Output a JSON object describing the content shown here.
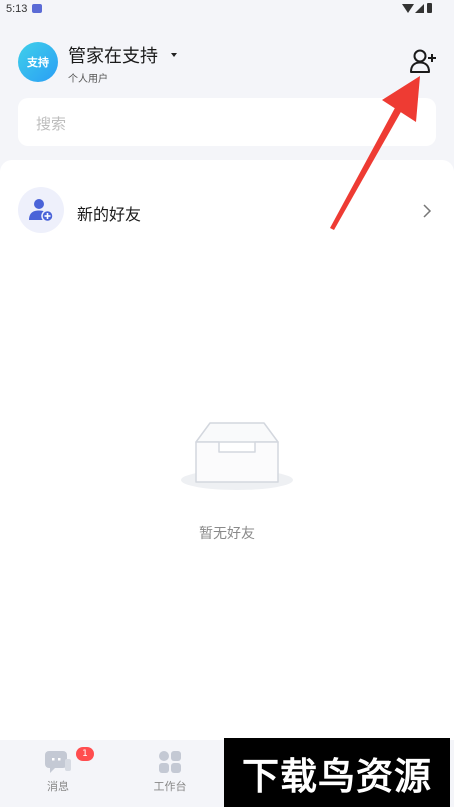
{
  "status_bar": {
    "time": "5:13"
  },
  "header": {
    "avatar_text": "支持",
    "user_name": "管家在支持",
    "user_type": "个人用户",
    "add_friend_icon": "add-user-icon"
  },
  "search": {
    "placeholder": "搜索"
  },
  "contacts": {
    "new_friends_label": "新的好友",
    "new_friends_icon": "user-plus-icon"
  },
  "empty_state": {
    "text": "暂无好友",
    "icon": "empty-inbox-icon"
  },
  "bottom_nav": {
    "items": [
      {
        "label": "消息",
        "icon": "chat-icon",
        "badge": "1"
      },
      {
        "label": "工作台",
        "icon": "grid-icon"
      }
    ]
  },
  "watermark": {
    "text": "下载鸟资源"
  },
  "colors": {
    "accent": "#5b73e8",
    "badge": "#ff4d4f",
    "annotation_arrow": "#ee3b33",
    "page_bg": "#f4f5f9"
  }
}
